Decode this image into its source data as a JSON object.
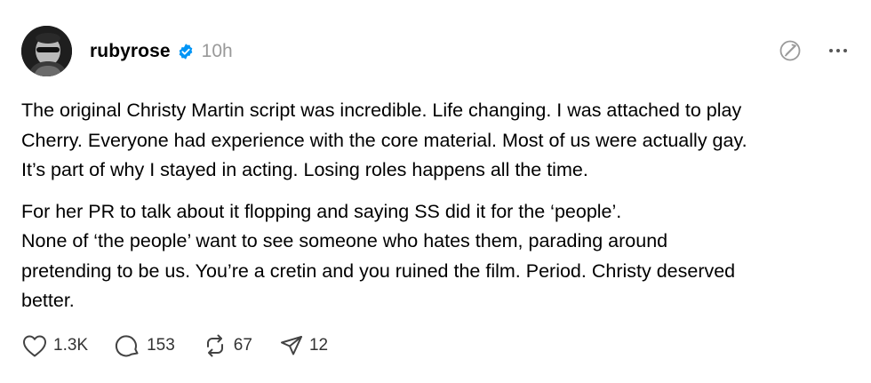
{
  "post": {
    "username": "rubyrose",
    "timestamp": "10h",
    "paragraphs": [
      {
        "lines": [
          "The original Christy Martin script was incredible. Life changing. I was attached to play",
          "Cherry. Everyone had experience with the core material. Most of us were actually gay.",
          "It’s part of why I stayed in acting. Losing roles happens all the time."
        ]
      },
      {
        "lines": [
          "For her PR to talk about it flopping and saying SS did it for the ‘people’.",
          "None of ‘the people’ want to see someone who hates them, parading around",
          "pretending to be us. You’re a cretin and you ruined the film. Period. Christy deserved",
          "better."
        ]
      }
    ],
    "engagement": {
      "likes": "1.3K",
      "replies": "153",
      "reposts": "67",
      "shares": "12"
    }
  },
  "colors": {
    "verified": "#0095F6",
    "timestamp": "#999999",
    "icon": "#424242"
  },
  "icons": [
    "avatar",
    "verified-icon",
    "ai-label-icon",
    "more-icon",
    "heart-icon",
    "comment-icon",
    "repost-icon",
    "share-icon"
  ]
}
